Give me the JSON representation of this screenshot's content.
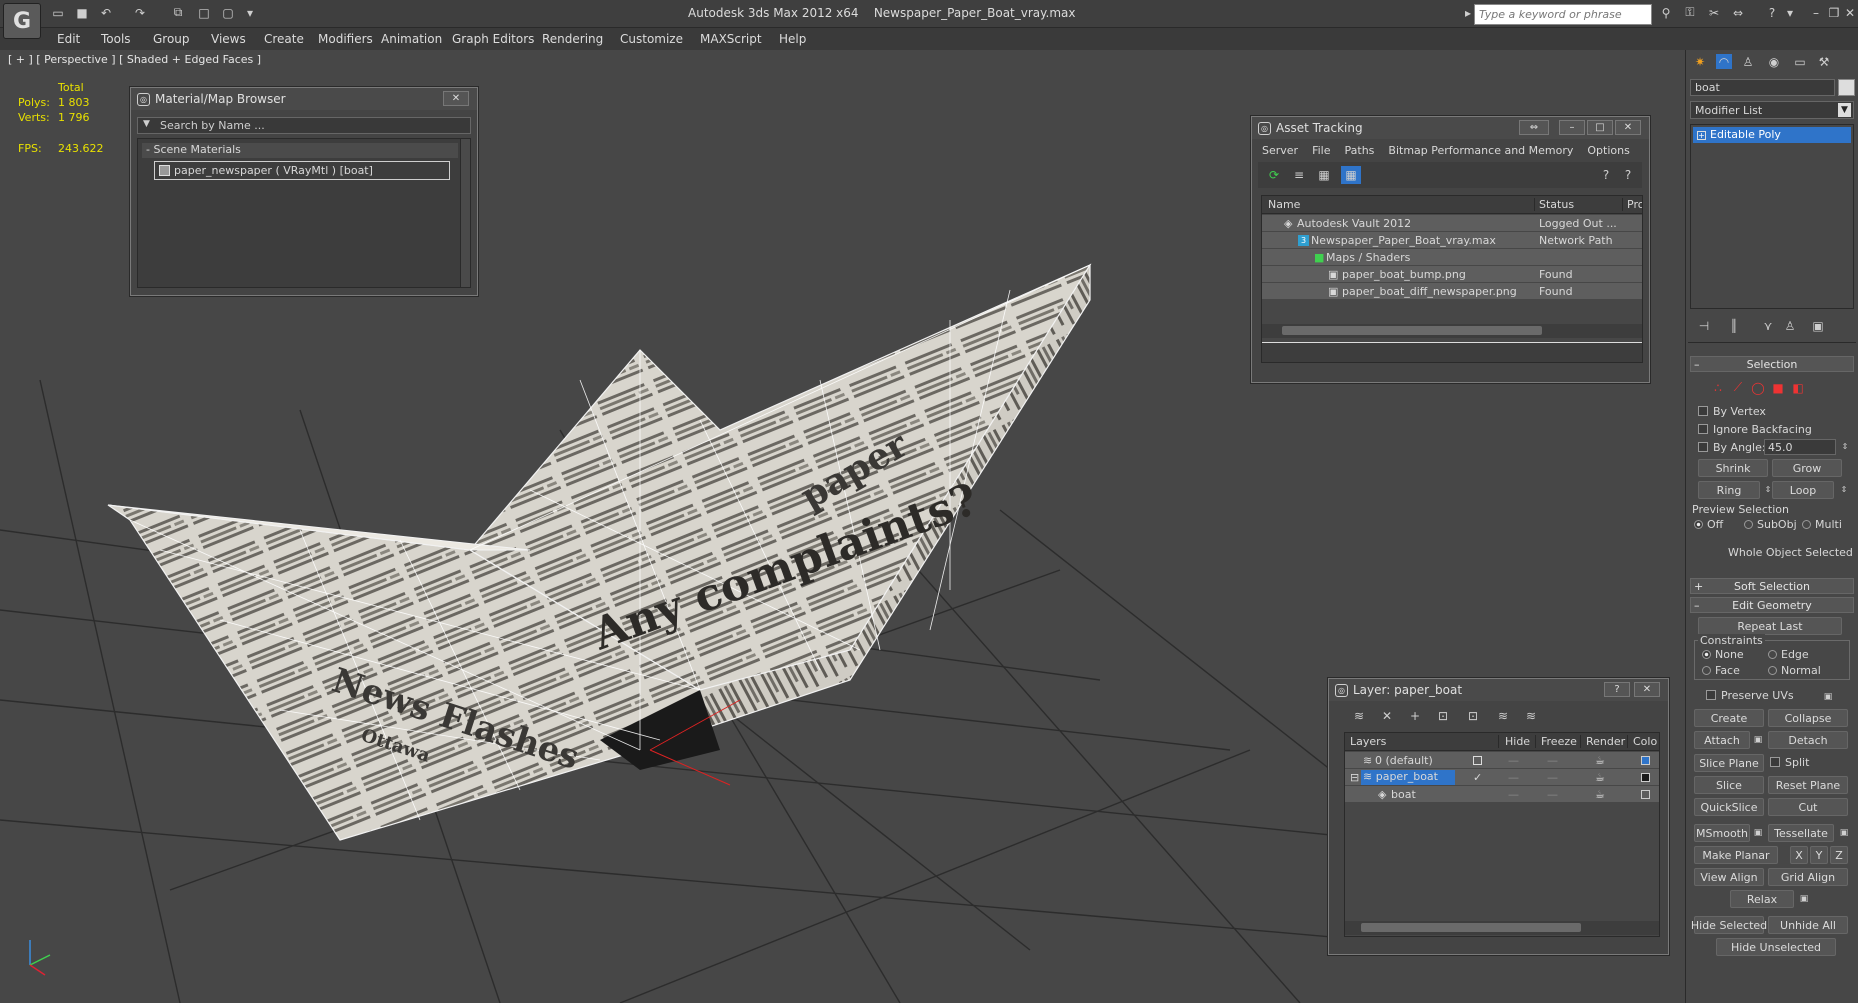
{
  "app": {
    "title": "Autodesk 3ds Max  2012 x64",
    "file": "Newspaper_Paper_Boat_vray.max",
    "search_placeholder": "Type a keyword or phrase",
    "logo_glyph": "G"
  },
  "menu": [
    "Edit",
    "Tools",
    "Group",
    "Views",
    "Create",
    "Modifiers",
    "Animation",
    "Graph Editors",
    "Rendering",
    "Customize",
    "MAXScript",
    "Help"
  ],
  "viewport": {
    "label": "[ + ] [ Perspective ] [ Shaded + Edged Faces ]",
    "stats": {
      "header": "Total",
      "polys_label": "Polys:",
      "polys": "1 803",
      "verts_label": "Verts:",
      "verts": "1 796",
      "fps_label": "FPS:",
      "fps": "243.622"
    },
    "newspaper_text": [
      "Any complaints?",
      "News Flashes",
      "Ottawa",
      "paper"
    ]
  },
  "material_browser": {
    "title": "Material/Map Browser",
    "search_placeholder": "Search by Name ...",
    "section": "- Scene Materials",
    "item": "paper_newspaper  ( VRayMtl ) [boat]"
  },
  "asset_tracking": {
    "title": "Asset Tracking",
    "menu": [
      "Server",
      "File",
      "Paths",
      "Bitmap Performance and Memory",
      "Options"
    ],
    "columns": [
      "Name",
      "Status",
      "Pro"
    ],
    "rows": [
      {
        "name": "Autodesk Vault 2012",
        "status": "Logged Out ..."
      },
      {
        "name": "Newspaper_Paper_Boat_vray.max",
        "status": "Network Path"
      },
      {
        "name": "Maps / Shaders",
        "status": ""
      },
      {
        "name": "paper_boat_bump.png",
        "status": "Found"
      },
      {
        "name": "paper_boat_diff_newspaper.png",
        "status": "Found"
      }
    ]
  },
  "layer_manager": {
    "title": "Layer: paper_boat",
    "columns": [
      "Layers",
      "Hide",
      "Freeze",
      "Render",
      "Colo"
    ],
    "rows": [
      {
        "name": "0 (default)"
      },
      {
        "name": "paper_boat"
      },
      {
        "name": "boat"
      }
    ]
  },
  "command_panel": {
    "object_name": "boat",
    "modifier_list": "Modifier List",
    "stack_item": "Editable Poly",
    "selection": {
      "header": "Selection",
      "by_vertex": "By Vertex",
      "ignore_backfacing": "Ignore Backfacing",
      "by_angle": "By Angle:",
      "angle_value": "45.0",
      "shrink": "Shrink",
      "grow": "Grow",
      "ring": "Ring",
      "loop": "Loop",
      "preview_label": "Preview Selection",
      "off": "Off",
      "subobj": "SubObj",
      "multi": "Multi",
      "status": "Whole Object Selected"
    },
    "soft_selection": "Soft Selection",
    "edit_geometry": {
      "header": "Edit Geometry",
      "repeat_last": "Repeat Last",
      "constraints": "Constraints",
      "none": "None",
      "edge": "Edge",
      "face": "Face",
      "normal": "Normal",
      "preserve_uvs": "Preserve UVs",
      "create": "Create",
      "collapse": "Collapse",
      "attach": "Attach",
      "detach": "Detach",
      "slice_plane": "Slice Plane",
      "split": "Split",
      "slice": "Slice",
      "reset_plane": "Reset Plane",
      "quickslice": "QuickSlice",
      "cut": "Cut",
      "msmooth": "MSmooth",
      "tessellate": "Tessellate",
      "make_planar": "Make Planar",
      "x": "X",
      "y": "Y",
      "z": "Z",
      "view_align": "View Align",
      "grid_align": "Grid Align",
      "relax": "Relax",
      "hide_selected": "Hide Selected",
      "unhide_all": "Unhide All",
      "hide_unselected": "Hide Unselected"
    }
  }
}
